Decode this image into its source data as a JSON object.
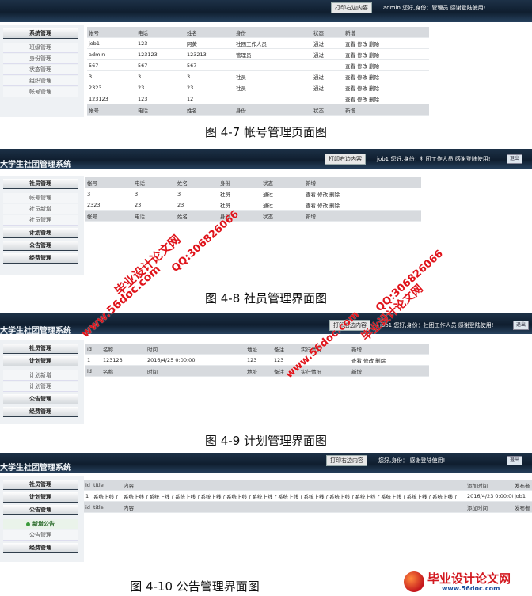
{
  "shots": [
    {
      "app_title": "",
      "print_label": "打印右边内容",
      "welcome": "admin 您好,身份：管理员 感谢登陆使用!",
      "exit_label": "",
      "sidebar": [
        {
          "label": "系统管理",
          "kind": "head"
        },
        {
          "label": "班级管理",
          "kind": "sub"
        },
        {
          "label": "身份管理",
          "kind": "sub"
        },
        {
          "label": "状态管理",
          "kind": "sub"
        },
        {
          "label": "组织管理",
          "kind": "sub"
        },
        {
          "label": "帐号管理",
          "kind": "sub"
        }
      ],
      "columns": [
        "帐号",
        "电话",
        "姓名",
        "身份",
        "状态",
        "新增"
      ],
      "rows": [
        [
          "job1",
          "123",
          "阿黄",
          "社团工作人员",
          "通过",
          "查看 修改 删除"
        ],
        [
          "admin",
          "123123",
          "123213",
          "管理员",
          "通过",
          "查看 修改 删除"
        ],
        [
          "567",
          "567",
          "567",
          "",
          "",
          "查看 修改 删除"
        ],
        [
          "3",
          "3",
          "3",
          "社员",
          "通过",
          "查看 修改 删除"
        ],
        [
          "2323",
          "23",
          "23",
          "社员",
          "通过",
          "查看 修改 删除"
        ],
        [
          "123123",
          "123",
          "12",
          "",
          "",
          "查看 修改 删除"
        ]
      ],
      "caption": "图 4-7 帐号管理页面图"
    },
    {
      "app_title": "大学生社团管理系统",
      "print_label": "打印右边内容",
      "welcome": "job1 您好,身份：社团工作人员 感谢登陆使用!",
      "exit_label": "退出",
      "sidebar": [
        {
          "label": "社员管理",
          "kind": "head"
        },
        {
          "label": "帐号管理",
          "kind": "sub"
        },
        {
          "label": "社员新增",
          "kind": "sub"
        },
        {
          "label": "社员管理",
          "kind": "sub"
        },
        {
          "label": "计划管理",
          "kind": "head"
        },
        {
          "label": "公告管理",
          "kind": "head"
        },
        {
          "label": "经费管理",
          "kind": "head"
        }
      ],
      "columns": [
        "帐号",
        "电话",
        "姓名",
        "身份",
        "状态",
        "新增"
      ],
      "rows": [
        [
          "3",
          "3",
          "3",
          "社员",
          "通过",
          "查看 修改 删除"
        ],
        [
          "2323",
          "23",
          "23",
          "社员",
          "通过",
          "查看 修改 删除"
        ]
      ],
      "caption": "图 4-8 社员管理界面图"
    },
    {
      "app_title": "大学生社团管理系统",
      "print_label": "打印右边内容",
      "welcome": "job1 您好,身份：社团工作人员 感谢登陆使用!",
      "exit_label": "退出",
      "sidebar": [
        {
          "label": "社员管理",
          "kind": "head"
        },
        {
          "label": "计划管理",
          "kind": "head"
        },
        {
          "label": "计划新增",
          "kind": "sub"
        },
        {
          "label": "计划管理",
          "kind": "sub"
        },
        {
          "label": "公告管理",
          "kind": "head"
        },
        {
          "label": "经费管理",
          "kind": "head"
        }
      ],
      "columns": [
        "id",
        "名称",
        "时间",
        "地址",
        "备注",
        "实行情况",
        "新增"
      ],
      "rows": [
        [
          "1",
          "123123",
          "2016/4/25 0:00:00",
          "123",
          "123",
          "",
          "查看 修改 删除"
        ]
      ],
      "caption": "图 4-9 计划管理界面图"
    },
    {
      "app_title": "大学生社团管理系统",
      "print_label": "打印右边内容",
      "welcome": "您好,身份： 感谢登陆使用!",
      "exit_label": "退出",
      "sidebar": [
        {
          "label": "社员管理",
          "kind": "head"
        },
        {
          "label": "计划管理",
          "kind": "head"
        },
        {
          "label": "公告管理",
          "kind": "head"
        },
        {
          "label": "新增公告",
          "kind": "active"
        },
        {
          "label": "公告管理",
          "kind": "sub"
        },
        {
          "label": "经费管理",
          "kind": "head"
        }
      ],
      "columns": [
        "id",
        "title",
        "内容",
        "添加时间",
        "发布者"
      ],
      "rows": [
        [
          "1",
          "系统上线了",
          "系统上线了系统上线了系统上线了系统上线了系统上线了系统上线了系统上线了系统上线了系统上线了系统上线了系统上线了系统上线了系统上线了",
          "2016/4/23 0:00:00",
          "job1"
        ]
      ],
      "caption": "图 4-10 公告管理界面图"
    }
  ],
  "watermarks": {
    "site": "www.56doc.com",
    "brand": "毕业设计论文网",
    "qq": "QQ:306826066"
  },
  "logo": {
    "name": "毕业设计论文网",
    "url": "www.56doc.com"
  },
  "colors": {
    "topbar": "#0f1e2f",
    "watermark": "#e0141b",
    "table_header": "#d7dade"
  }
}
